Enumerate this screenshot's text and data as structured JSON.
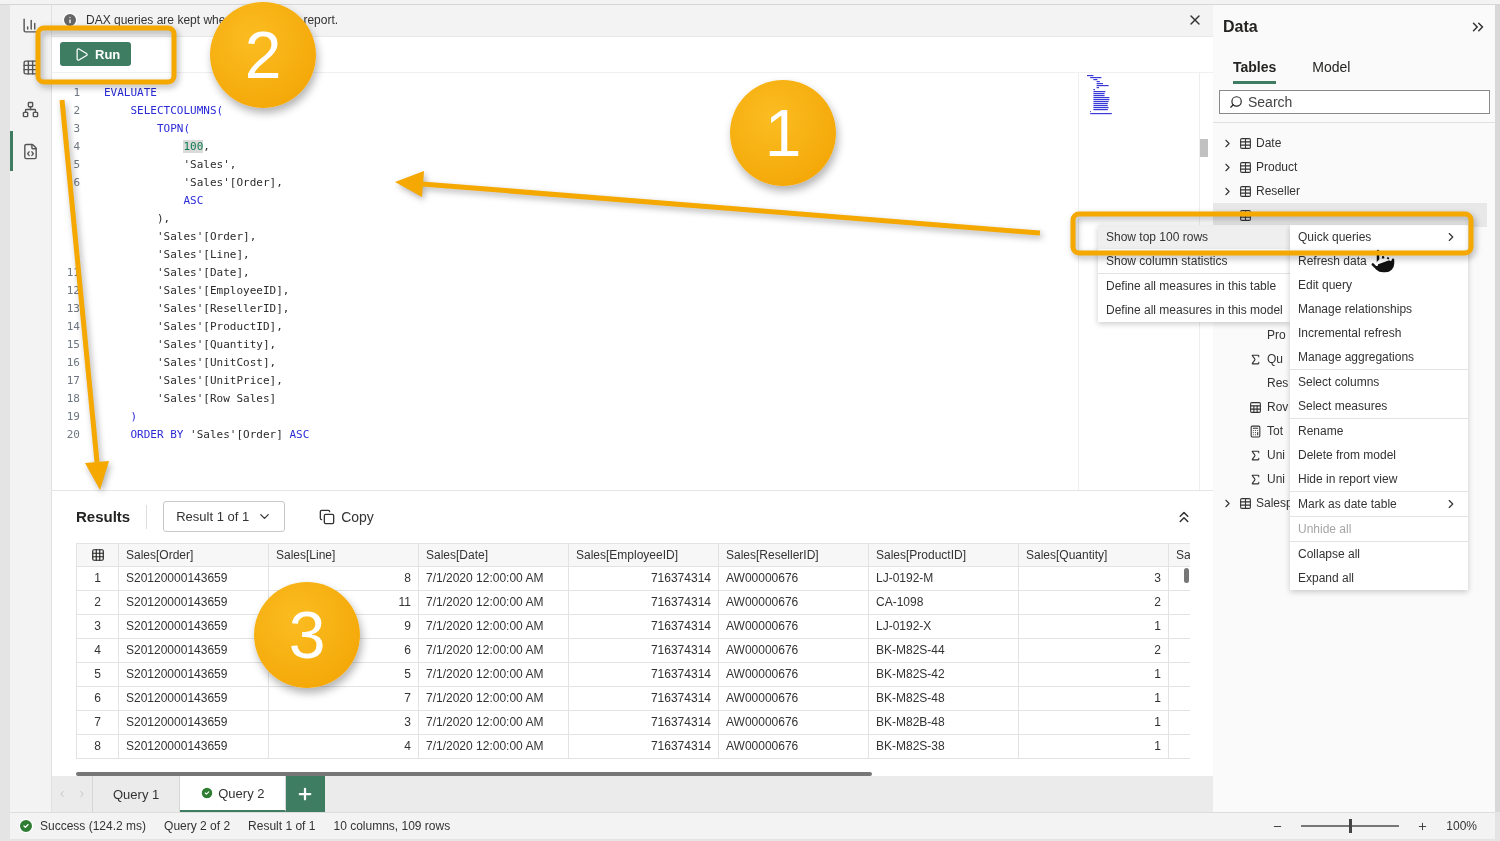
{
  "info_bar": {
    "texts": [
      "DAX queries are kept whe",
      "report."
    ]
  },
  "toolbar": {
    "run_button": "Run"
  },
  "editor": {
    "lines": [
      {
        "number": "1",
        "code": [
          {
            "text": "EVALUATE",
            "kind": "keyword"
          }
        ]
      },
      {
        "number": "2",
        "code": [
          {
            "text": "    SELECTCOLUMNS(",
            "kind": "keyword"
          }
        ]
      },
      {
        "number": "3",
        "code": [
          {
            "text": "        TOPN(",
            "kind": "keyword"
          }
        ]
      },
      {
        "number": "4",
        "code": [
          {
            "text": "            100",
            "kind": "number"
          },
          {
            "text": ",",
            "kind": "plain"
          }
        ]
      },
      {
        "number": "5",
        "code": [
          {
            "text": "            'Sales',",
            "kind": "ref"
          }
        ]
      },
      {
        "number": "6",
        "code": [
          {
            "text": "            'Sales'[Order],",
            "kind": "ref"
          }
        ]
      },
      {
        "code": [
          {
            "text": "            ASC",
            "kind": "keyword"
          }
        ]
      },
      {
        "code": [
          {
            "text": "        ),",
            "kind": "plain"
          }
        ]
      },
      {
        "code": [
          {
            "text": "        'Sales'[Order],",
            "kind": "ref"
          }
        ]
      },
      {
        "code": [
          {
            "text": "        'Sales'[Line],",
            "kind": "ref"
          }
        ]
      },
      {
        "number": "11",
        "code": [
          {
            "text": "        'Sales'[Date],",
            "kind": "ref"
          }
        ]
      },
      {
        "number": "12",
        "code": [
          {
            "text": "        'Sales'[EmployeeID],",
            "kind": "ref"
          }
        ]
      },
      {
        "number": "13",
        "code": [
          {
            "text": "        'Sales'[ResellerID],",
            "kind": "ref"
          }
        ]
      },
      {
        "number": "14",
        "code": [
          {
            "text": "        'Sales'[ProductID],",
            "kind": "ref"
          }
        ]
      },
      {
        "number": "15",
        "code": [
          {
            "text": "        'Sales'[Quantity],",
            "kind": "ref"
          }
        ]
      },
      {
        "number": "16",
        "code": [
          {
            "text": "        'Sales'[UnitCost],",
            "kind": "ref"
          }
        ]
      },
      {
        "number": "17",
        "code": [
          {
            "text": "        'Sales'[UnitPrice],",
            "kind": "ref"
          }
        ]
      },
      {
        "number": "18",
        "code": [
          {
            "text": "        'Sales'[Row Sales]",
            "kind": "ref"
          }
        ]
      },
      {
        "number": "19",
        "code": [
          {
            "text": "    )",
            "kind": "keyword"
          }
        ]
      },
      {
        "number": "20",
        "code": [
          {
            "text": "    ORDER BY ",
            "kind": "keyword"
          },
          {
            "text": "'Sales'[Order]",
            "kind": "ref"
          },
          {
            "text": " ASC",
            "kind": "keyword"
          }
        ]
      }
    ]
  },
  "results": {
    "title": "Results",
    "result_picker": "Result 1 of 1",
    "copy_button": "Copy",
    "table": {
      "columns": [
        {
          "label": "Sales[Order]",
          "numeric": false
        },
        {
          "label": "Sales[Line]",
          "numeric": true
        },
        {
          "label": "Sales[Date]",
          "numeric": false
        },
        {
          "label": "Sales[EmployeeID]",
          "numeric": true
        },
        {
          "label": "Sales[ResellerID]",
          "numeric": false
        },
        {
          "label": "Sales[ProductID]",
          "numeric": false
        },
        {
          "label": "Sales[Quantity]",
          "numeric": true
        },
        {
          "label": "Sa"
        }
      ],
      "rows": [
        {
          "number": "1",
          "cells": [
            "S20120000143659",
            "8",
            "7/1/2020 12:00:00 AM",
            "716374314",
            "AW00000676",
            "LJ-0192-M",
            "3"
          ]
        },
        {
          "number": "2",
          "cells": [
            "S20120000143659",
            "11",
            "7/1/2020 12:00:00 AM",
            "716374314",
            "AW00000676",
            "CA-1098",
            "2"
          ]
        },
        {
          "number": "3",
          "cells": [
            "S20120000143659",
            "9",
            "7/1/2020 12:00:00 AM",
            "716374314",
            "AW00000676",
            "LJ-0192-X",
            "1"
          ]
        },
        {
          "number": "4",
          "cells": [
            "S20120000143659",
            "6",
            "7/1/2020 12:00:00 AM",
            "716374314",
            "AW00000676",
            "BK-M82S-44",
            "2"
          ]
        },
        {
          "number": "5",
          "cells": [
            "S20120000143659",
            "5",
            "7/1/2020 12:00:00 AM",
            "716374314",
            "AW00000676",
            "BK-M82S-42",
            "1"
          ]
        },
        {
          "number": "6",
          "cells": [
            "S20120000143659",
            "7",
            "7/1/2020 12:00:00 AM",
            "716374314",
            "AW00000676",
            "BK-M82S-48",
            "1"
          ]
        },
        {
          "number": "7",
          "cells": [
            "S20120000143659",
            "3",
            "7/1/2020 12:00:00 AM",
            "716374314",
            "AW00000676",
            "BK-M82B-48",
            "1"
          ]
        },
        {
          "number": "8",
          "cells": [
            "S20120000143659",
            "4",
            "7/1/2020 12:00:00 AM",
            "716374314",
            "AW00000676",
            "BK-M82S-38",
            "1"
          ]
        }
      ]
    }
  },
  "query_tabs": [
    {
      "label": "Query 1",
      "selected": false,
      "succeeded": false
    },
    {
      "label": "Query 2",
      "selected": true,
      "succeeded": true
    }
  ],
  "status_bar": {
    "items": [
      {
        "text": "Success (124.2 ms)",
        "kind": "success"
      },
      {
        "text": "Query 2 of 2",
        "kind": "plain"
      },
      {
        "text": "Result 1 of 1",
        "kind": "plain"
      },
      {
        "text": "10 columns, 109 rows",
        "kind": "plain"
      }
    ],
    "zoom": {
      "level": 0.5,
      "reading": "100%"
    }
  },
  "data_pane": {
    "title": "Data",
    "tabs": [
      {
        "label": "Tables",
        "selected": true
      },
      {
        "label": "Model",
        "selected": false
      }
    ],
    "search": {
      "placeholder": "Search"
    },
    "tree": [
      {
        "label": "Date",
        "kind": "table",
        "expanded": false
      },
      {
        "label": "Product",
        "kind": "table",
        "expanded": false
      },
      {
        "label": "Reseller",
        "kind": "table",
        "expanded": false
      },
      {
        "kind": "table",
        "expanded": true,
        "children": [
          {
            "label": "Pro",
            "kind": "column"
          },
          {
            "label": "Qu",
            "kind": "sum"
          },
          {
            "label": "Res",
            "kind": "column"
          },
          {
            "label": "Rov",
            "kind": "calculated"
          },
          {
            "label": "Tot",
            "kind": "measure"
          },
          {
            "label": "Uni",
            "kind": "sum"
          },
          {
            "label": "Uni",
            "kind": "sum"
          }
        ]
      },
      {
        "label": "Salesp",
        "kind": "table",
        "expanded": false
      }
    ]
  },
  "submenu": {
    "groups": [
      [
        {
          "label": "Show top 100 rows",
          "selected": true
        },
        {
          "label": "Show column statistics",
          "selected": false
        }
      ],
      [
        {
          "label": "Define all measures in this table",
          "selected": false
        },
        {
          "label": "Define all measures in this model",
          "selected": false
        }
      ]
    ]
  },
  "context_menu": {
    "groups": [
      [
        {
          "label": "Quick queries",
          "submenu": true,
          "disabled": false
        },
        {
          "label": "Refresh data",
          "submenu": false,
          "disabled": false
        },
        {
          "label": "Edit query",
          "submenu": false,
          "disabled": false
        },
        {
          "label": "Manage relationships",
          "submenu": false,
          "disabled": false
        },
        {
          "label": "Incremental refresh",
          "submenu": false,
          "disabled": false
        },
        {
          "label": "Manage aggregations",
          "submenu": false,
          "disabled": false
        }
      ],
      [
        {
          "label": "Select columns",
          "submenu": false,
          "disabled": false
        },
        {
          "label": "Select measures",
          "submenu": false,
          "disabled": false
        }
      ],
      [
        {
          "label": "Rename",
          "submenu": false,
          "disabled": false
        },
        {
          "label": "Delete from model",
          "submenu": false,
          "disabled": false
        },
        {
          "label": "Hide in report view",
          "submenu": false,
          "disabled": false
        }
      ],
      [
        {
          "label": "Mark as date table",
          "submenu": true,
          "disabled": false
        }
      ],
      [
        {
          "label": "Unhide all",
          "submenu": false,
          "disabled": true
        }
      ],
      [
        {
          "label": "Collapse all",
          "submenu": false,
          "disabled": false
        },
        {
          "label": "Expand all",
          "submenu": false,
          "disabled": false
        }
      ]
    ]
  },
  "callouts": [
    {
      "number": "1"
    },
    {
      "number": "2"
    },
    {
      "number": "3"
    }
  ]
}
